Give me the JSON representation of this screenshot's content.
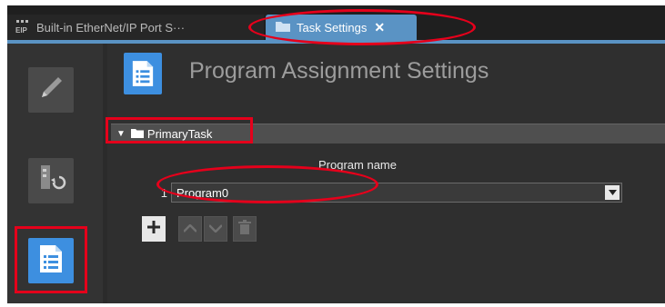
{
  "tabs": [
    {
      "label": "Built-in EtherNet/IP Port S···",
      "icon": "eip-port-icon",
      "active": false
    },
    {
      "label": "Task Settings",
      "icon": "folder-icon",
      "active": true,
      "close_glyph": "✕"
    }
  ],
  "left_toolbar": {
    "items": [
      {
        "icon": "edit-pencil-icon",
        "active": false
      },
      {
        "icon": "transfer-icon",
        "active": false
      },
      {
        "icon": "program-assignment-icon",
        "active": true
      }
    ]
  },
  "main": {
    "title": "Program Assignment Settings",
    "title_icon": "program-assignment-icon",
    "task": {
      "expand_glyph": "▼",
      "icon": "folder-icon",
      "name": "PrimaryTask"
    },
    "table": {
      "column_header": "Program name",
      "rows": [
        {
          "index": "1",
          "program": "Program0"
        }
      ]
    },
    "actions": [
      {
        "icon": "add-icon",
        "enabled": true
      },
      {
        "icon": "move-up-icon",
        "enabled": false
      },
      {
        "icon": "move-down-icon",
        "enabled": false
      },
      {
        "icon": "delete-icon",
        "enabled": false
      }
    ]
  },
  "colors": {
    "accent": "#3d8fe0",
    "active_tab": "#5a93c4",
    "background": "#2b2b2b",
    "annotation": "#e5001b"
  }
}
